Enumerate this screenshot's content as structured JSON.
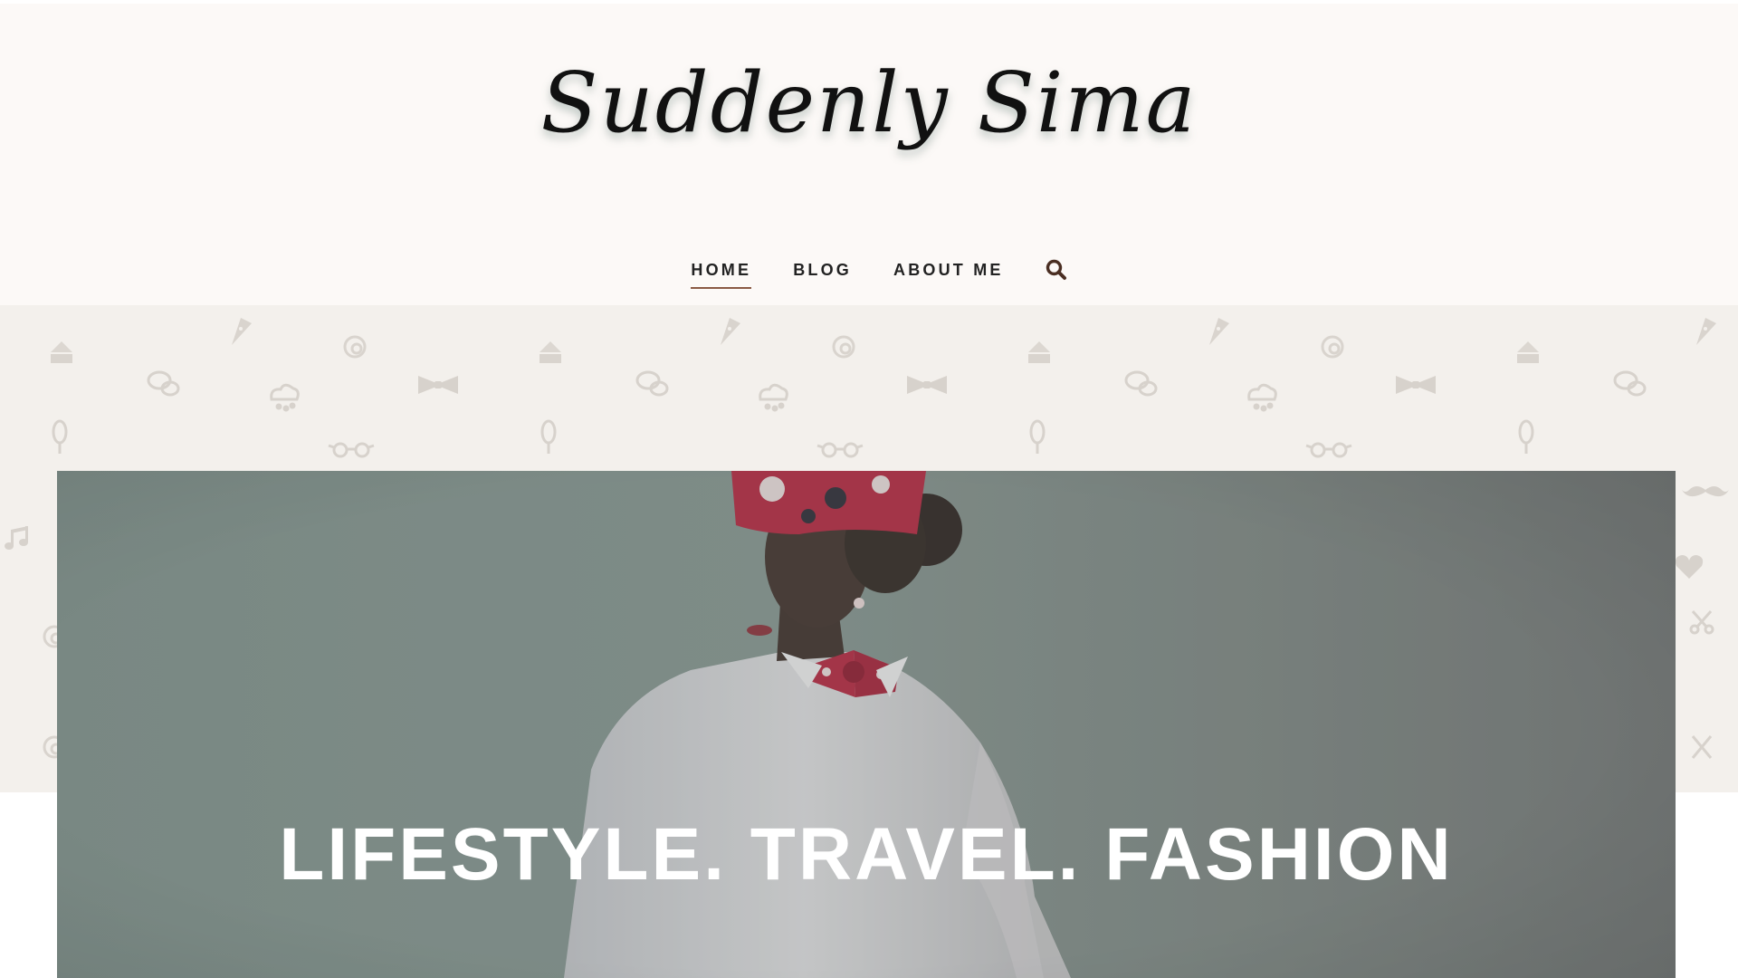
{
  "site": {
    "logo_text": "Suddenly Sima"
  },
  "nav": {
    "items": [
      {
        "label": "HOME",
        "active": true
      },
      {
        "label": "BLOG",
        "active": false
      },
      {
        "label": "ABOUT ME",
        "active": false
      }
    ],
    "search_icon": "search-icon"
  },
  "hero": {
    "title": "LIFESTYLE. TRAVEL. FASHION",
    "image_subject": "woman-portrait"
  },
  "pattern_icons": [
    "cake-icon",
    "pizza-icon",
    "shell-icon",
    "speech-bubbles-icon",
    "cloud-icon",
    "bow-tie-icon",
    "glasses-icon",
    "microphone-icon",
    "music-note-icon",
    "heart-icon",
    "scissors-icon",
    "mustache-icon",
    "cutlery-icon"
  ],
  "colors": {
    "header_bg": "#fcf9f7",
    "pattern_bg": "#f3f0ec",
    "nav_active_underline": "#8a5a44",
    "search_icon": "#4a2e22"
  }
}
